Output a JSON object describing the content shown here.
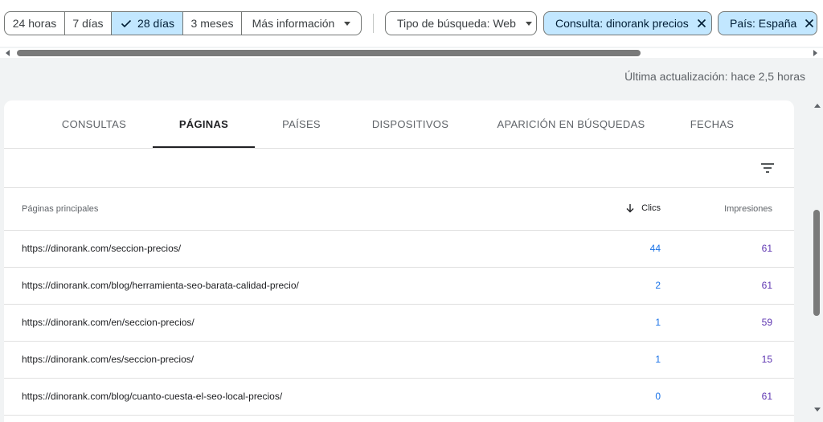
{
  "date_range": {
    "options": [
      {
        "label": "24 horas",
        "selected": false
      },
      {
        "label": "7 días",
        "selected": false
      },
      {
        "label": "28 días",
        "selected": true
      },
      {
        "label": "3 meses",
        "selected": false
      }
    ],
    "more_label": "Más información"
  },
  "filters": {
    "search_type": "Tipo de búsqueda: Web",
    "query_chip": "Consulta: dinorank precios",
    "country_chip": "País: España"
  },
  "last_update": "Última actualización: hace 2,5 horas",
  "tabs": [
    {
      "label": "CONSULTAS",
      "active": false
    },
    {
      "label": "PÁGINAS",
      "active": true
    },
    {
      "label": "PAÍSES",
      "active": false
    },
    {
      "label": "DISPOSITIVOS",
      "active": false
    },
    {
      "label": "APARICIÓN EN BÚSQUEDAS",
      "active": false
    },
    {
      "label": "FECHAS",
      "active": false
    }
  ],
  "table": {
    "columns": {
      "page": "Páginas principales",
      "clicks": "Clics",
      "impressions": "Impresiones"
    },
    "rows": [
      {
        "url": "https://dinorank.com/seccion-precios/",
        "clicks": "44",
        "impressions": "61"
      },
      {
        "url": "https://dinorank.com/blog/herramienta-seo-barata-calidad-precio/",
        "clicks": "2",
        "impressions": "61"
      },
      {
        "url": "https://dinorank.com/en/seccion-precios/",
        "clicks": "1",
        "impressions": "59"
      },
      {
        "url": "https://dinorank.com/es/seccion-precios/",
        "clicks": "1",
        "impressions": "15"
      },
      {
        "url": "https://dinorank.com/blog/cuanto-cuesta-el-seo-local-precios/",
        "clicks": "0",
        "impressions": "61"
      }
    ]
  },
  "colors": {
    "selected_chip": "#c2e7ff",
    "clicks_blue": "#1a73e8",
    "impressions_purple": "#5e35b1",
    "active_tab": "#202124"
  }
}
